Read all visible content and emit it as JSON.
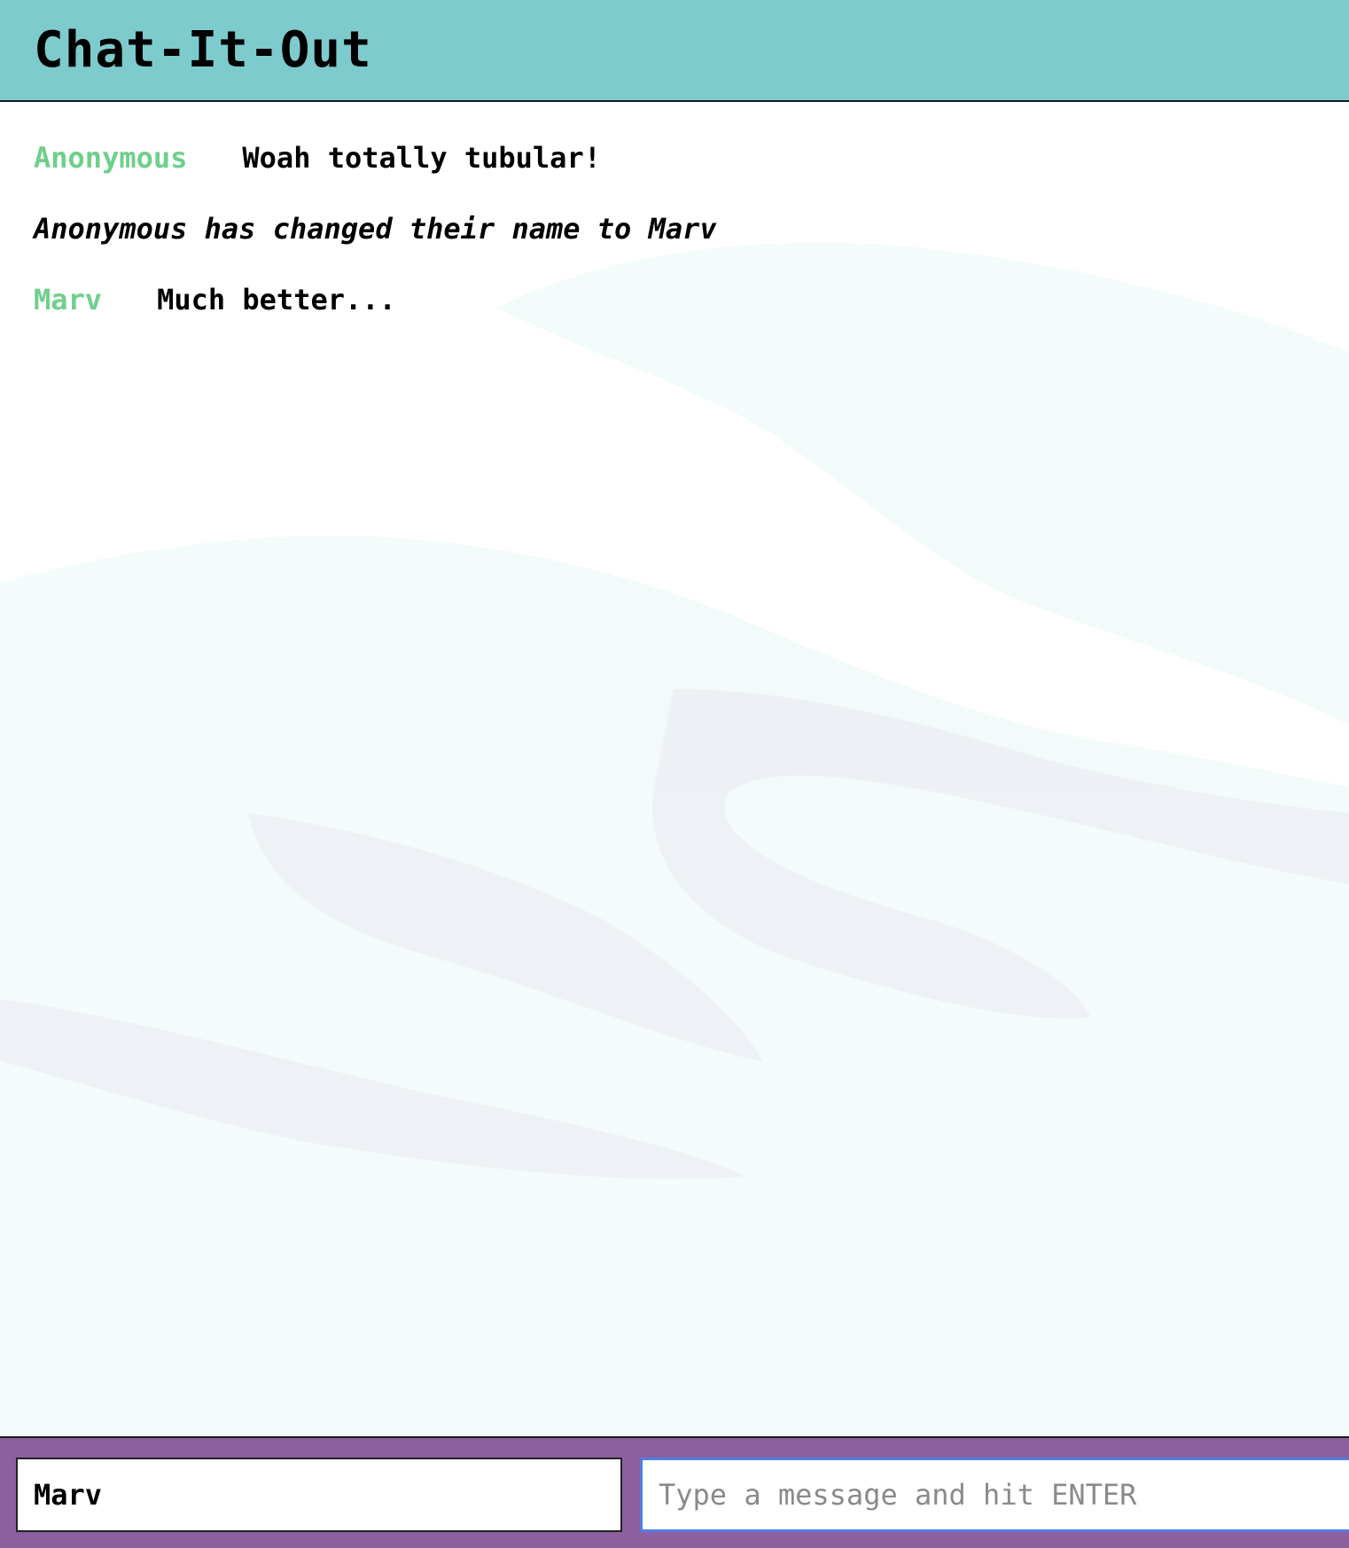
{
  "app": {
    "title": "Chat-It-Out"
  },
  "messages": [
    {
      "type": "chat",
      "user": "Anonymous",
      "text": "Woah totally tubular!"
    },
    {
      "type": "system",
      "text": "Anonymous has changed their name to Marv"
    },
    {
      "type": "chat",
      "user": "Marv",
      "text": "Much better..."
    }
  ],
  "footer": {
    "name_value": "Marv",
    "message_placeholder": "Type a message and hit ENTER",
    "message_value": ""
  },
  "colors": {
    "header_bg": "#7ecbcd",
    "footer_bg": "#8b5fa0",
    "username": "#6fcf8c",
    "input_focus_border": "#4f7fe0"
  }
}
